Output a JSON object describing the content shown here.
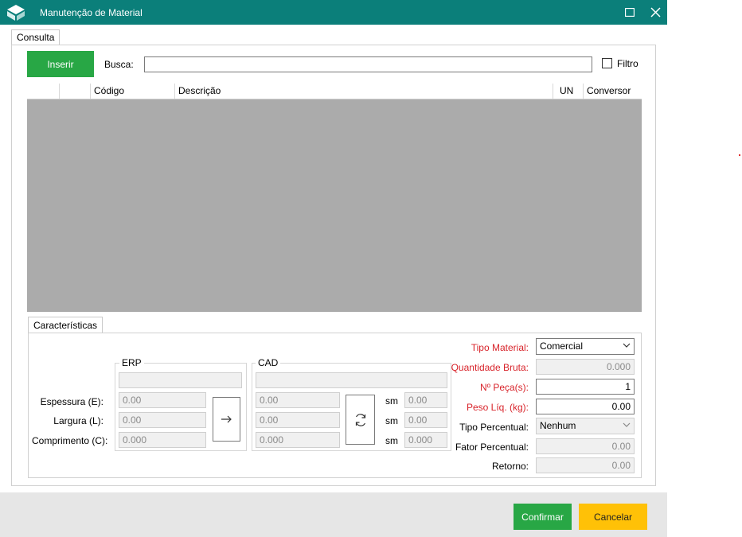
{
  "window": {
    "title": "Manutenção de Material"
  },
  "tabs": {
    "consulta": "Consulta",
    "caracteristicas": "Características"
  },
  "toolbar": {
    "insert_label": "Inserir",
    "search_label": "Busca:",
    "search_value": "",
    "filter_label": "Filtro",
    "filter_checked": false
  },
  "grid": {
    "columns": [
      "",
      "",
      "Código",
      "Descrição",
      "UN",
      "Conversor"
    ],
    "rows": []
  },
  "erp": {
    "title": "ERP",
    "name": "",
    "espessura": "0.00",
    "largura": "0.00",
    "comprimento": "0.000"
  },
  "cad": {
    "title": "CAD",
    "name": "",
    "espessura": "0.00",
    "largura": "0.00",
    "comprimento": "0.000",
    "sm_label": "sm",
    "sm_espessura": "0.00",
    "sm_largura": "0.00",
    "sm_comprimento": "0.000"
  },
  "dims": {
    "espessura_label": "Espessura (E):",
    "largura_label": "Largura (L):",
    "comprimento_label": "Comprimento (C):"
  },
  "props": {
    "tipo_material_label": "Tipo Material:",
    "tipo_material_value": "Comercial",
    "quantidade_bruta_label": "Quantidade Bruta:",
    "quantidade_bruta_value": "0.000",
    "n_peca_label": "Nº Peça(s):",
    "n_peca_value": "1",
    "peso_liq_label": "Peso Líq. (kg):",
    "peso_liq_value": "0.00",
    "tipo_percentual_label": "Tipo Percentual:",
    "tipo_percentual_value": "Nenhum",
    "fator_percentual_label": "Fator Percentual:",
    "fator_percentual_value": "0.00",
    "retorno_label": "Retorno:",
    "retorno_value": "0.00"
  },
  "footer": {
    "confirm_label": "Confirmar",
    "cancel_label": "Cancelar"
  },
  "colors": {
    "titlebar": "#0b7f7a",
    "green": "#28a745",
    "yellow": "#ffc107",
    "required": "#d8232a",
    "grid_body": "#ababab"
  }
}
